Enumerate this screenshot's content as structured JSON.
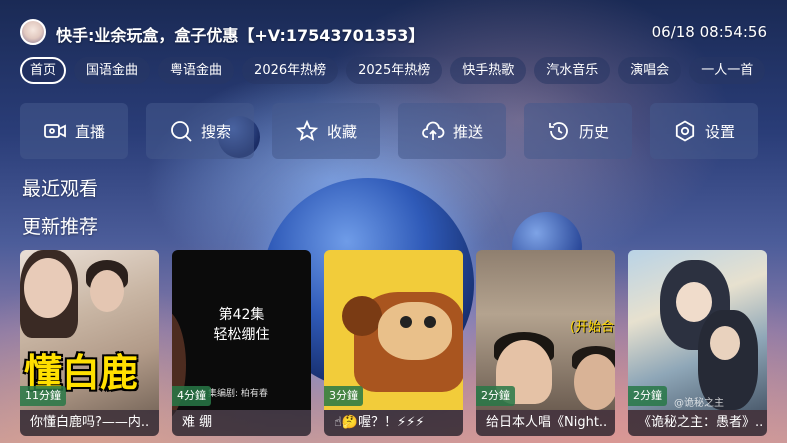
{
  "header": {
    "title": "快手:业余玩盒，盒子优惠【+V:17543701353】",
    "datetime": "06/18 08:54:56"
  },
  "tabs": [
    {
      "label": "首页",
      "active": true
    },
    {
      "label": "国语金曲"
    },
    {
      "label": "粤语金曲"
    },
    {
      "label": "2026年热榜"
    },
    {
      "label": "2025年热榜"
    },
    {
      "label": "快手热歌"
    },
    {
      "label": "汽水音乐"
    },
    {
      "label": "演唱会"
    },
    {
      "label": "一人一首"
    }
  ],
  "actions": [
    {
      "label": "直播",
      "icon": "camera-icon"
    },
    {
      "label": "搜索",
      "icon": "search-icon"
    },
    {
      "label": "收藏",
      "icon": "star-icon"
    },
    {
      "label": "推送",
      "icon": "cloud-upload-icon"
    },
    {
      "label": "历史",
      "icon": "history-icon"
    },
    {
      "label": "设置",
      "icon": "gear-icon"
    }
  ],
  "sections": {
    "recent": "最近观看",
    "updates": "更新推荐"
  },
  "cards": [
    {
      "caption": "你懂白鹿吗?——内..",
      "duration": "11分鐘",
      "overlay": "懂白鹿"
    },
    {
      "caption": "难 绷",
      "duration": "4分鐘",
      "episode": "第42集",
      "subtitle": "轻松绷住",
      "small": "集编剧: 柏有春"
    },
    {
      "caption": "☝🤔喔？！⚡⚡⚡",
      "duration": "3分鐘"
    },
    {
      "caption": "给日本人唱《Night..",
      "duration": "2分鐘",
      "overlay": "(开始合"
    },
    {
      "caption": "《诡秘之主：愚者》..",
      "duration": "2分鐘",
      "watermark": "@诡秘之主"
    }
  ]
}
